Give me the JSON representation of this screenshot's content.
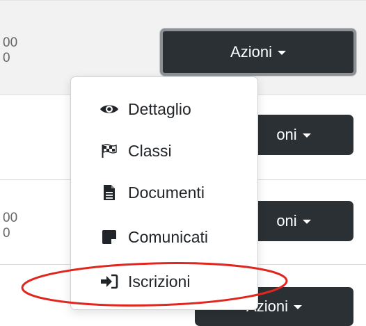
{
  "rows": [
    {
      "text_line1": "00",
      "text_line2": "0",
      "actions_label": "Azioni"
    },
    {
      "actions_label": "oni"
    },
    {
      "text_line1": "00",
      "text_line2": "0",
      "actions_label": "oni"
    },
    {
      "actions_label": "Azioni"
    }
  ],
  "dropdown": {
    "items": [
      {
        "label": "Dettaglio",
        "icon": "eye-icon"
      },
      {
        "label": "Classi",
        "icon": "checkered-flag-icon"
      },
      {
        "label": "Documenti",
        "icon": "document-icon"
      },
      {
        "label": "Comunicati",
        "icon": "note-icon"
      },
      {
        "label": "Iscrizioni",
        "icon": "sign-in-icon"
      }
    ]
  },
  "annotation": {
    "color": "#e0271f",
    "target": "Iscrizioni"
  }
}
